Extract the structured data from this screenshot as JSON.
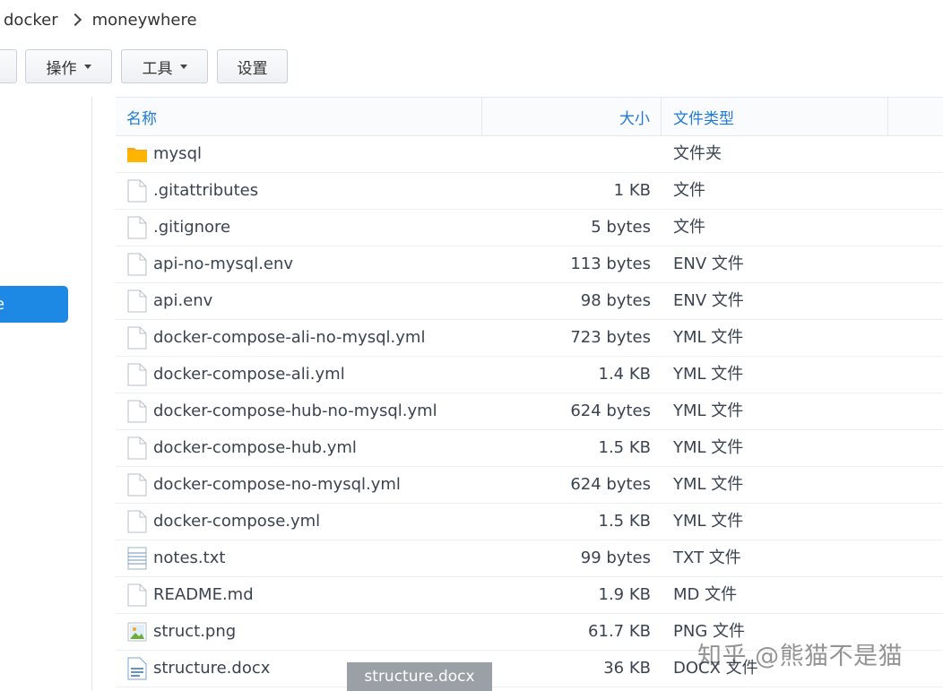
{
  "breadcrumb": {
    "items": [
      "docker",
      "moneywhere"
    ]
  },
  "toolbar": {
    "action_label": "操作",
    "tools_label": "工具",
    "settings_label": "设置"
  },
  "sidebar": {
    "selected_label": "e"
  },
  "columns": {
    "name": "名称",
    "size": "大小",
    "type": "文件类型"
  },
  "files": [
    {
      "name": "mysql",
      "size": "",
      "type": "文件夹",
      "icon": "folder-icon"
    },
    {
      "name": ".gitattributes",
      "size": "1 KB",
      "type": "文件",
      "icon": "file-icon"
    },
    {
      "name": ".gitignore",
      "size": "5 bytes",
      "type": "文件",
      "icon": "file-icon"
    },
    {
      "name": "api-no-mysql.env",
      "size": "113 bytes",
      "type": "ENV 文件",
      "icon": "file-icon"
    },
    {
      "name": "api.env",
      "size": "98 bytes",
      "type": "ENV 文件",
      "icon": "file-icon"
    },
    {
      "name": "docker-compose-ali-no-mysql.yml",
      "size": "723 bytes",
      "type": "YML 文件",
      "icon": "file-icon"
    },
    {
      "name": "docker-compose-ali.yml",
      "size": "1.4 KB",
      "type": "YML 文件",
      "icon": "file-icon"
    },
    {
      "name": "docker-compose-hub-no-mysql.yml",
      "size": "624 bytes",
      "type": "YML 文件",
      "icon": "file-icon"
    },
    {
      "name": "docker-compose-hub.yml",
      "size": "1.5 KB",
      "type": "YML 文件",
      "icon": "file-icon"
    },
    {
      "name": "docker-compose-no-mysql.yml",
      "size": "624 bytes",
      "type": "YML 文件",
      "icon": "file-icon"
    },
    {
      "name": "docker-compose.yml",
      "size": "1.5 KB",
      "type": "YML 文件",
      "icon": "file-icon"
    },
    {
      "name": "notes.txt",
      "size": "99 bytes",
      "type": "TXT 文件",
      "icon": "text-file-icon"
    },
    {
      "name": "README.md",
      "size": "1.9 KB",
      "type": "MD 文件",
      "icon": "file-icon"
    },
    {
      "name": "struct.png",
      "size": "61.7 KB",
      "type": "PNG 文件",
      "icon": "image-file-icon"
    },
    {
      "name": "structure.docx",
      "size": "36 KB",
      "type": "DOCX 文件",
      "icon": "document-file-icon"
    }
  ],
  "tooltip": {
    "text": "structure.docx"
  },
  "watermark": {
    "text": "知乎 @熊猫不是猫"
  },
  "colors": {
    "accent": "#1e88e5",
    "header_text": "#1f7bd6",
    "folder": "#f5a623"
  }
}
